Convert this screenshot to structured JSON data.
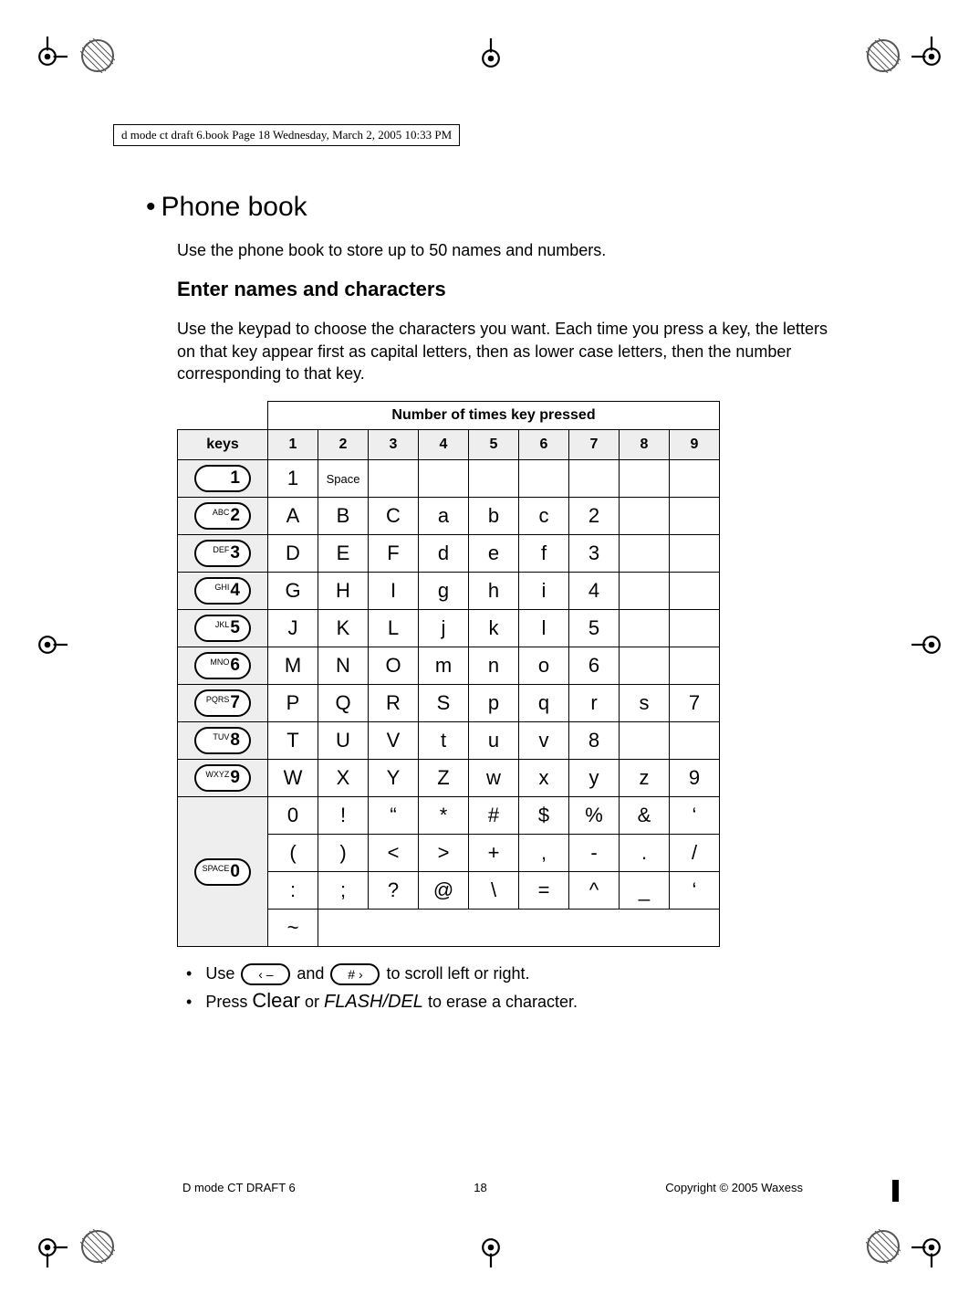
{
  "header_banner": "d mode ct draft 6.book  Page 18  Wednesday, March 2, 2005  10:33 PM",
  "title_bullet": "•",
  "title": "Phone book",
  "intro": "Use the phone book to store up to 50 names and numbers.",
  "subheading": "Enter names and characters",
  "paragraph": "Use the keypad to choose the characters you want. Each time you press a key, the letters on that key appear first as capital letters, then as lower case letters, then the number corresponding to that key.",
  "table_header": "Number of times key pressed",
  "keys_label": "keys",
  "col_headers": [
    "1",
    "2",
    "3",
    "4",
    "5",
    "6",
    "7",
    "8",
    "9"
  ],
  "key_labels": {
    "k1": {
      "sup": "",
      "num": "1"
    },
    "k2": {
      "sup": "ABC",
      "num": "2"
    },
    "k3": {
      "sup": "DEF",
      "num": "3"
    },
    "k4": {
      "sup": "GHI",
      "num": "4"
    },
    "k5": {
      "sup": "JKL",
      "num": "5"
    },
    "k6": {
      "sup": "MNO",
      "num": "6"
    },
    "k7": {
      "sup": "PQRS",
      "num": "7"
    },
    "k8": {
      "sup": "TUV",
      "num": "8"
    },
    "k9": {
      "sup": "WXYZ",
      "num": "9"
    },
    "k0": {
      "sup": "SPACE",
      "num": "0"
    }
  },
  "rows": {
    "r1": [
      "1",
      "Space",
      "",
      "",
      "",
      "",
      "",
      "",
      ""
    ],
    "r2": [
      "A",
      "B",
      "C",
      "a",
      "b",
      "c",
      "2",
      "",
      ""
    ],
    "r3": [
      "D",
      "E",
      "F",
      "d",
      "e",
      "f",
      "3",
      "",
      ""
    ],
    "r4": [
      "G",
      "H",
      "I",
      "g",
      "h",
      "i",
      "4",
      "",
      ""
    ],
    "r5": [
      "J",
      "K",
      "L",
      "j",
      "k",
      "l",
      "5",
      "",
      ""
    ],
    "r6": [
      "M",
      "N",
      "O",
      "m",
      "n",
      "o",
      "6",
      "",
      ""
    ],
    "r7": [
      "P",
      "Q",
      "R",
      "S",
      "p",
      "q",
      "r",
      "s",
      "7"
    ],
    "r8": [
      "T",
      "U",
      "V",
      "t",
      "u",
      "v",
      "8",
      "",
      ""
    ],
    "r9": [
      "W",
      "X",
      "Y",
      "Z",
      "w",
      "x",
      "y",
      "z",
      "9"
    ],
    "r0a": [
      "0",
      "!",
      "“",
      "*",
      "#",
      "$",
      "%",
      "&",
      "‘"
    ],
    "r0b": [
      "(",
      ")",
      "<",
      ">",
      "+",
      ",",
      "-",
      ".",
      "/"
    ],
    "r0c": [
      ":",
      ";",
      "?",
      "@",
      "\\",
      "=",
      "^",
      "_",
      "‘"
    ],
    "r0d": [
      "~",
      "",
      "",
      "",
      "",
      "",
      "",
      "",
      ""
    ]
  },
  "bullet1_a": "Use",
  "bullet1_left_btn": "‹ –",
  "bullet1_b": "and",
  "bullet1_right_btn": "# ›",
  "bullet1_c": "to scroll left or right.",
  "bullet2_a": "Press",
  "bullet2_clear": "Clear",
  "bullet2_b": "or",
  "bullet2_flash": "FLASH/DEL",
  "bullet2_c": "to erase a character.",
  "footer_left": "D mode CT DRAFT 6",
  "footer_center": "18",
  "footer_right": "Copyright © 2005 Waxess"
}
